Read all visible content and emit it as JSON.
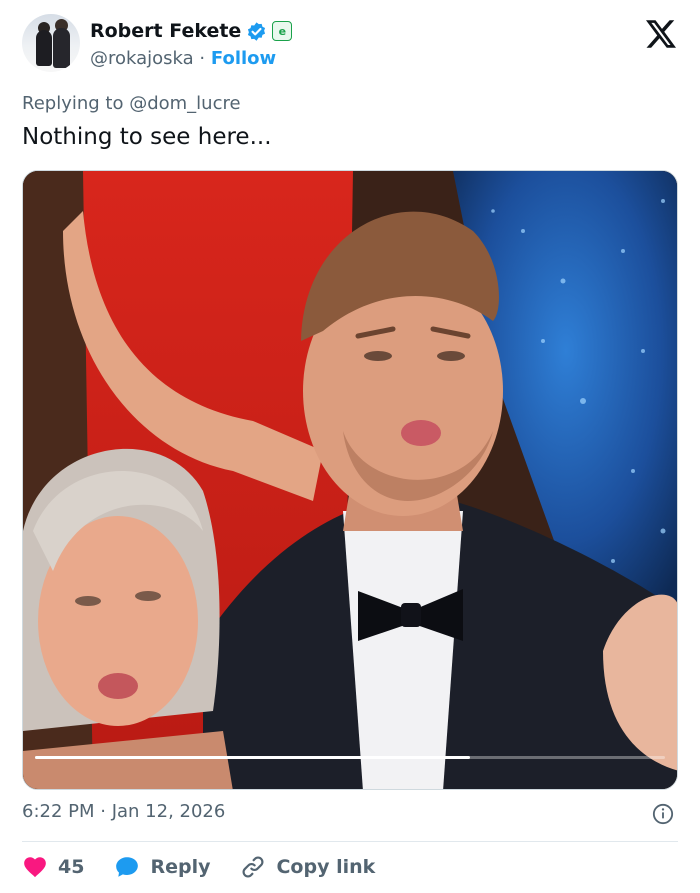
{
  "author": {
    "name": "Robert Fekete",
    "handle": "@rokajoska",
    "follow_label": "Follow",
    "separator": "·",
    "affiliate_badge_text": "e"
  },
  "reply_context": "Replying to @dom_lucre",
  "tweet_text": "Nothing to see here...",
  "video": {
    "progress_fraction": 0.69
  },
  "timestamp": "6:22 PM · Jan 12, 2026",
  "actions": {
    "like_count": "45",
    "reply_label": "Reply",
    "copy_link_label": "Copy link"
  },
  "colors": {
    "accent": "#1d9bf0",
    "like": "#f91880",
    "text_secondary": "#536471",
    "affiliate": "#1aa14a"
  },
  "icons": {
    "logo": "x-logo-icon",
    "verified": "verified-badge-icon",
    "info": "info-icon",
    "like": "heart-icon",
    "reply": "speech-bubble-icon",
    "copy_link": "link-icon"
  }
}
